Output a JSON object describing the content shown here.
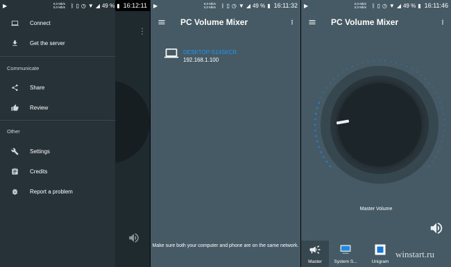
{
  "status_bars": [
    {
      "net": "0,0 Mb/s\n0,0 Mb/s",
      "battery": "49 %",
      "time": "16:12:11"
    },
    {
      "net": "0,0 Mb/s\n0,0 Mb/s",
      "battery": "49 %",
      "time": "16:11:32"
    },
    {
      "net": "0,0 Mb/s\n0,0 Mb/s",
      "battery": "49 %",
      "time": "16:11:46"
    }
  ],
  "drawer": {
    "items_top": [
      {
        "label": "Connect",
        "icon": "laptop-icon"
      },
      {
        "label": "Get the server",
        "icon": "download-icon"
      }
    ],
    "section_communicate": "Communicate",
    "items_communicate": [
      {
        "label": "Share",
        "icon": "share-icon"
      },
      {
        "label": "Review",
        "icon": "thumb-up-icon"
      }
    ],
    "section_other": "Other",
    "items_other": [
      {
        "label": "Settings",
        "icon": "wrench-icon"
      },
      {
        "label": "Credits",
        "icon": "clipboard-icon"
      },
      {
        "label": "Report a problem",
        "icon": "bug-icon"
      }
    ]
  },
  "app_title": "PC Volume Mixer",
  "connect_screen": {
    "host_name": "DESKTOP-S14SKCR",
    "host_ip": "192.168.1.100",
    "hint": "Make sure both your computer and phone are on the same network."
  },
  "mixer_screen": {
    "dial_label": "Master Volume",
    "apps": [
      {
        "label": "Master",
        "icon": "megaphone-icon",
        "active": true
      },
      {
        "label": "System S...",
        "icon": "monitor-icon",
        "active": false
      },
      {
        "label": "Unigram",
        "icon": "unigram-icon",
        "active": false
      }
    ]
  },
  "watermark": "winstart.ru",
  "colors": {
    "toolbar_bg": "#455a64",
    "drawer_bg": "#263238",
    "accent": "#2196f3"
  }
}
